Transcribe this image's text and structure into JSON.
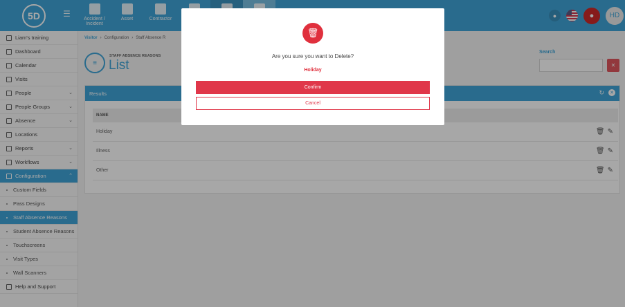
{
  "header": {
    "logo_text": "5D",
    "nav": [
      {
        "label": "Accident / Incident",
        "icon": "first-aid-icon"
      },
      {
        "label": "Asset",
        "icon": "boxes-icon"
      },
      {
        "label": "Contractor",
        "icon": "hard-hat-icon"
      },
      {
        "label": "",
        "icon": "document-icon"
      },
      {
        "label": "",
        "icon": "person-icon"
      },
      {
        "label": "",
        "icon": "shield-icon"
      }
    ],
    "avatar_initials": "HD"
  },
  "sidebar": {
    "items": [
      {
        "label": "Liam's training",
        "icon": "branch-icon"
      },
      {
        "label": "Dashboard",
        "icon": "dashboard-icon"
      },
      {
        "label": "Calendar",
        "icon": "calendar-icon"
      },
      {
        "label": "Visits",
        "icon": "visits-icon"
      },
      {
        "label": "People",
        "icon": "people-icon"
      },
      {
        "label": "People Groups",
        "icon": "people-groups-icon"
      },
      {
        "label": "Absence",
        "icon": "absence-icon"
      },
      {
        "label": "Locations",
        "icon": "locations-icon"
      },
      {
        "label": "Reports",
        "icon": "reports-icon"
      },
      {
        "label": "Workflows",
        "icon": "workflows-icon"
      },
      {
        "label": "Configuration",
        "icon": "configuration-icon"
      }
    ],
    "sub_items": [
      {
        "label": "Custom Fields"
      },
      {
        "label": "Pass Designs"
      },
      {
        "label": "Staff Absence Reasons"
      },
      {
        "label": "Student Absence Reasons"
      },
      {
        "label": "Touchscreens"
      },
      {
        "label": "Visit Types"
      },
      {
        "label": "Wall Scanners"
      }
    ],
    "help": {
      "label": "Help and Support"
    }
  },
  "main": {
    "breadcrumb": [
      "Visitor",
      "Configuration",
      "Staff Absence R"
    ],
    "subtitle": "STAFF ABSENCE REASONS",
    "title": "List",
    "search_label": "Search",
    "search_value": "",
    "panel_title": "Results",
    "table": {
      "header": "NAME",
      "rows": [
        "Holiday",
        "Illness",
        "Other"
      ]
    }
  },
  "modal": {
    "question": "Are you sure you want to Delete?",
    "item_name": "Holiday",
    "confirm_label": "Confirm",
    "cancel_label": "Cancel"
  },
  "colors": {
    "primary": "#1a93cf",
    "danger": "#e0374a"
  }
}
